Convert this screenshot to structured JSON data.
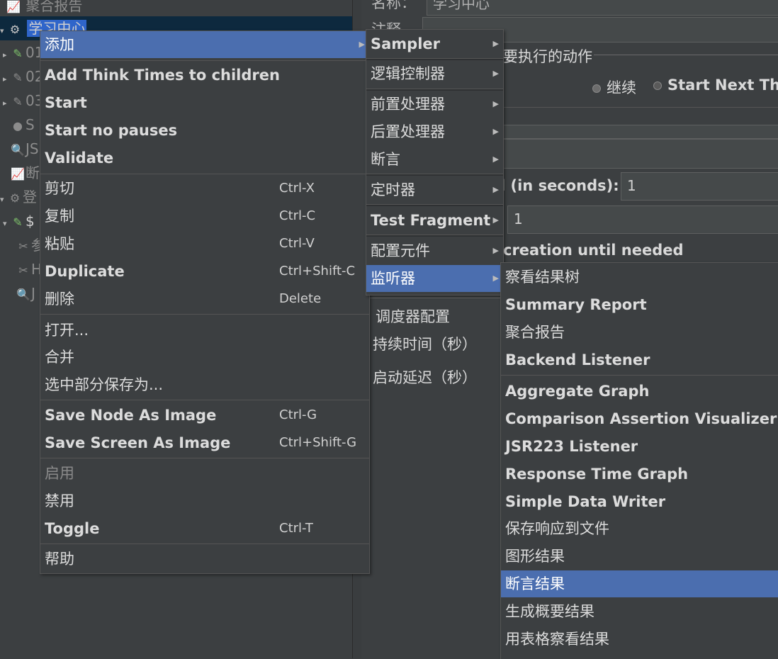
{
  "tree": {
    "items": [
      {
        "label": "聚合报告",
        "icon": "chart-icon",
        "arrow": ""
      },
      {
        "label": "学习中心",
        "icon": "gear-icon",
        "arrow": "▾"
      },
      {
        "label": "01",
        "icon": "pencil-icon",
        "arrow": "▸"
      },
      {
        "label": "02",
        "icon": "pencil-icon",
        "arrow": "▸"
      },
      {
        "label": "03",
        "icon": "pencil-icon",
        "arrow": "▸"
      },
      {
        "label": "S",
        "icon": "shield-icon",
        "arrow": ""
      },
      {
        "label": "JS",
        "icon": "magnifier-icon",
        "arrow": ""
      },
      {
        "label": "断",
        "icon": "chart-icon",
        "arrow": ""
      },
      {
        "label": "登",
        "icon": "gear-icon",
        "arrow": "▾"
      },
      {
        "label": "$",
        "icon": "pencil-icon",
        "arrow": "▾"
      },
      {
        "label": "参",
        "icon": "tools-icon",
        "arrow": ""
      },
      {
        "label": "H",
        "icon": "tools-icon",
        "arrow": ""
      },
      {
        "label": "J",
        "icon": "magnifier-icon",
        "arrow": ""
      }
    ]
  },
  "panel": {
    "name_label": "名称：",
    "name_value": "学习中心",
    "comment_label": "注释",
    "action_title": "要执行的动作",
    "radio_continue": "继续",
    "radio_next": "Start Next Thr",
    "ramp_label": "l (in seconds):",
    "ramp_value": "1",
    "loop_value": "1",
    "creation_text": "creation until needed",
    "scheduler_title": "调度器配置",
    "duration_label": "持续时间（秒）",
    "delay_label": "启动延迟（秒）"
  },
  "menu_main": {
    "add": "添加",
    "think_times": "Add Think Times to children",
    "start": "Start",
    "start_no_pauses": "Start no pauses",
    "validate": "Validate",
    "cut": "剪切",
    "cut_sc": "Ctrl-X",
    "copy": "复制",
    "copy_sc": "Ctrl-C",
    "paste": "粘贴",
    "paste_sc": "Ctrl-V",
    "duplicate": "Duplicate",
    "duplicate_sc": "Ctrl+Shift-C",
    "delete": "删除",
    "delete_sc": "Delete",
    "open": "打开...",
    "merge": "合并",
    "save_selection": "选中部分保存为...",
    "save_node_image": "Save Node As Image",
    "save_node_image_sc": "Ctrl-G",
    "save_screen_image": "Save Screen As Image",
    "save_screen_image_sc": "Ctrl+Shift-G",
    "enable": "启用",
    "disable": "禁用",
    "toggle": "Toggle",
    "toggle_sc": "Ctrl-T",
    "help": "帮助"
  },
  "menu_add": {
    "sampler": "Sampler",
    "logic_controller": "逻辑控制器",
    "pre_processor": "前置处理器",
    "post_processor": "后置处理器",
    "assertion": "断言",
    "timer": "定时器",
    "test_fragment": "Test Fragment",
    "config_element": "配置元件",
    "listener": "监听器"
  },
  "menu_listener": {
    "items": [
      "察看结果树",
      "Summary Report",
      "聚合报告",
      "Backend Listener",
      "Aggregate Graph",
      "Comparison Assertion Visualizer",
      "JSR223 Listener",
      "Response Time Graph",
      "Simple Data Writer",
      "保存响应到文件",
      "图形结果",
      "断言结果",
      "生成概要结果",
      "用表格察看结果"
    ]
  },
  "colors": {
    "background": "#3c3f41",
    "menu_selected": "#4b6eaf",
    "tree_selected": "#2f65ca"
  }
}
